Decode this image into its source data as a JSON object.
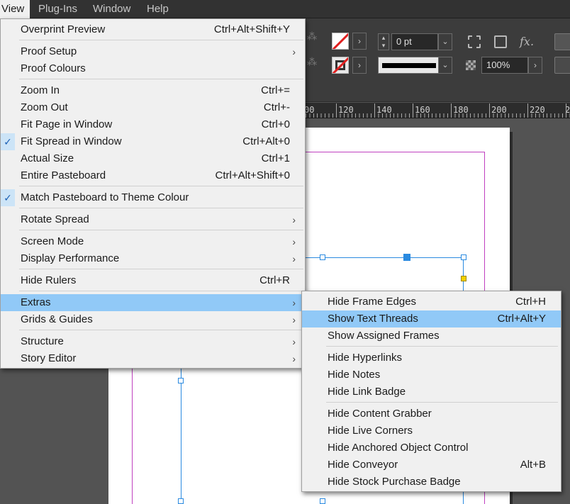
{
  "menubar": {
    "items": [
      {
        "label": "View",
        "active": true
      },
      {
        "label": "Plug-Ins",
        "active": false
      },
      {
        "label": "Window",
        "active": false
      },
      {
        "label": "Help",
        "active": false
      }
    ]
  },
  "control_panel": {
    "stroke_weight": "0 pt",
    "opacity": "100%",
    "fill_swatch": "none",
    "stroke_swatch": "none",
    "effects_icon": "fx.",
    "stroke_color": "#000000"
  },
  "ruler": {
    "labels": [
      "00",
      "120",
      "140",
      "160",
      "180",
      "200",
      "220",
      "2"
    ]
  },
  "view_menu": {
    "items": [
      {
        "label": "Overprint Preview",
        "shortcut": "Ctrl+Alt+Shift+Y"
      },
      {
        "label": "Proof Setup",
        "submenu": true
      },
      {
        "label": "Proof Colours"
      },
      {
        "label": "Zoom In",
        "shortcut": "Ctrl+="
      },
      {
        "label": "Zoom Out",
        "shortcut": "Ctrl+-"
      },
      {
        "label": "Fit Page in Window",
        "shortcut": "Ctrl+0"
      },
      {
        "label": "Fit Spread in Window",
        "shortcut": "Ctrl+Alt+0",
        "checked": true
      },
      {
        "label": "Actual Size",
        "shortcut": "Ctrl+1"
      },
      {
        "label": "Entire Pasteboard",
        "shortcut": "Ctrl+Alt+Shift+0"
      },
      {
        "label": "Match Pasteboard to Theme Colour",
        "checked": true
      },
      {
        "label": "Rotate Spread",
        "submenu": true
      },
      {
        "label": "Screen Mode",
        "submenu": true
      },
      {
        "label": "Display Performance",
        "submenu": true
      },
      {
        "label": "Hide Rulers",
        "shortcut": "Ctrl+R"
      },
      {
        "label": "Extras",
        "submenu": true,
        "highlighted": true
      },
      {
        "label": "Grids & Guides",
        "submenu": true
      },
      {
        "label": "Structure",
        "submenu": true
      },
      {
        "label": "Story Editor",
        "submenu": true
      }
    ]
  },
  "extras_submenu": {
    "items": [
      {
        "label": "Hide Frame Edges",
        "shortcut": "Ctrl+H"
      },
      {
        "label": "Show Text Threads",
        "shortcut": "Ctrl+Alt+Y",
        "highlighted": true
      },
      {
        "label": "Show Assigned Frames"
      },
      {
        "label": "Hide Hyperlinks"
      },
      {
        "label": "Hide Notes"
      },
      {
        "label": "Hide Link Badge"
      },
      {
        "label": "Hide Content Grabber"
      },
      {
        "label": "Hide Live Corners"
      },
      {
        "label": "Hide Anchored Object Control"
      },
      {
        "label": "Hide Conveyor",
        "shortcut": "Alt+B"
      },
      {
        "label": "Hide Stock Purchase Badge"
      }
    ]
  },
  "glyphs": {
    "submenu_arrow": "›",
    "check": "✓",
    "dropdown": "⌄",
    "right_arrow": "›"
  },
  "colors": {
    "menu_highlight": "#91c9f7",
    "check_background": "#cce4f7",
    "margin_guide": "#c040c0",
    "frame_edge": "#2a8ae0",
    "text_port": "#f0d000"
  }
}
